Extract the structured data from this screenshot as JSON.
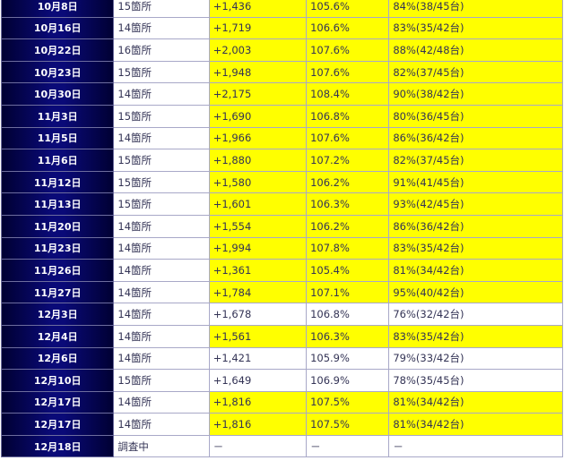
{
  "columns": [
    "date",
    "locations",
    "diff",
    "payout_rate",
    "win_ratio"
  ],
  "rows": [
    {
      "date": "10月8日",
      "locations": "15箇所",
      "diff": "+1,436",
      "rate": "105.6%",
      "ratio": "84%(38/45台)",
      "highlight": true
    },
    {
      "date": "10月16日",
      "locations": "14箇所",
      "diff": "+1,719",
      "rate": "106.6%",
      "ratio": "83%(35/42台)",
      "highlight": true
    },
    {
      "date": "10月22日",
      "locations": "16箇所",
      "diff": "+2,003",
      "rate": "107.6%",
      "ratio": "88%(42/48台)",
      "highlight": true
    },
    {
      "date": "10月23日",
      "locations": "15箇所",
      "diff": "+1,948",
      "rate": "107.6%",
      "ratio": "82%(37/45台)",
      "highlight": true
    },
    {
      "date": "10月30日",
      "locations": "14箇所",
      "diff": "+2,175",
      "rate": "108.4%",
      "ratio": "90%(38/42台)",
      "highlight": true
    },
    {
      "date": "11月3日",
      "locations": "15箇所",
      "diff": "+1,690",
      "rate": "106.8%",
      "ratio": "80%(36/45台)",
      "highlight": true
    },
    {
      "date": "11月5日",
      "locations": "14箇所",
      "diff": "+1,966",
      "rate": "107.6%",
      "ratio": "86%(36/42台)",
      "highlight": true
    },
    {
      "date": "11月6日",
      "locations": "15箇所",
      "diff": "+1,880",
      "rate": "107.2%",
      "ratio": "82%(37/45台)",
      "highlight": true
    },
    {
      "date": "11月12日",
      "locations": "15箇所",
      "diff": "+1,580",
      "rate": "106.2%",
      "ratio": "91%(41/45台)",
      "highlight": true
    },
    {
      "date": "11月13日",
      "locations": "15箇所",
      "diff": "+1,601",
      "rate": "106.3%",
      "ratio": "93%(42/45台)",
      "highlight": true
    },
    {
      "date": "11月20日",
      "locations": "14箇所",
      "diff": "+1,554",
      "rate": "106.2%",
      "ratio": "86%(36/42台)",
      "highlight": true
    },
    {
      "date": "11月23日",
      "locations": "14箇所",
      "diff": "+1,994",
      "rate": "107.8%",
      "ratio": "83%(35/42台)",
      "highlight": true
    },
    {
      "date": "11月26日",
      "locations": "14箇所",
      "diff": "+1,361",
      "rate": "105.4%",
      "ratio": "81%(34/42台)",
      "highlight": true
    },
    {
      "date": "11月27日",
      "locations": "14箇所",
      "diff": "+1,784",
      "rate": "107.1%",
      "ratio": "95%(40/42台)",
      "highlight": true
    },
    {
      "date": "12月3日",
      "locations": "14箇所",
      "diff": "+1,678",
      "rate": "106.8%",
      "ratio": "76%(32/42台)",
      "highlight": false
    },
    {
      "date": "12月4日",
      "locations": "14箇所",
      "diff": "+1,561",
      "rate": "106.3%",
      "ratio": "83%(35/42台)",
      "highlight": true
    },
    {
      "date": "12月6日",
      "locations": "14箇所",
      "diff": "+1,421",
      "rate": "105.9%",
      "ratio": "79%(33/42台)",
      "highlight": false
    },
    {
      "date": "12月10日",
      "locations": "15箇所",
      "diff": "+1,649",
      "rate": "106.9%",
      "ratio": "78%(35/45台)",
      "highlight": false
    },
    {
      "date": "12月17日",
      "locations": "14箇所",
      "diff": "+1,816",
      "rate": "107.5%",
      "ratio": "81%(34/42台)",
      "highlight": true
    },
    {
      "date": "12月17日",
      "locations": "14箇所",
      "diff": "+1,816",
      "rate": "107.5%",
      "ratio": "81%(34/42台)",
      "highlight": true
    },
    {
      "date": "12月18日",
      "locations": "調査中",
      "diff": "－",
      "rate": "－",
      "ratio": "－",
      "highlight": false
    }
  ],
  "colors": {
    "highlight": "#ffff00",
    "date_cell": "#0a0a78",
    "text": "#333355"
  }
}
